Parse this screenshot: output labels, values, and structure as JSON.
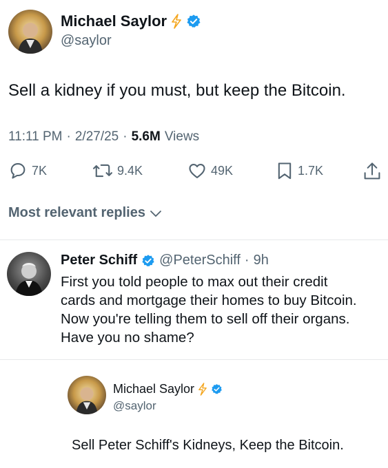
{
  "main_tweet": {
    "author_name": "Michael Saylor",
    "author_handle": "@saylor",
    "text": "Sell a kidney if you must, but keep the Bitcoin.",
    "time": "11:11 PM",
    "date": "2/27/25",
    "views_count": "5.6M",
    "views_label": "Views",
    "separator": "·",
    "actions": {
      "replies": "7K",
      "retweets": "9.4K",
      "likes": "49K",
      "bookmarks": "1.7K"
    }
  },
  "replies_header": {
    "label": "Most relevant replies",
    "icon": "chevron-down-icon"
  },
  "reply": {
    "author_name": "Peter Schiff",
    "author_handle": "@PeterSchiff",
    "age": "9h",
    "separator": "·",
    "text_lines": [
      "First you told people to max out their credit",
      "cards and mortgage their homes to buy Bitcoin.",
      "Now you're telling them to sell off their organs.",
      "Have you no shame?"
    ]
  },
  "response": {
    "author_name": "Michael Saylor",
    "author_handle": "@saylor",
    "text": "Sell Peter Schiff's Kidneys, Keep the Bitcoin."
  },
  "colors": {
    "verified": "#1d9bf0",
    "lightning": "#f4a51c",
    "text": "#0f1419",
    "muted": "#536471"
  }
}
